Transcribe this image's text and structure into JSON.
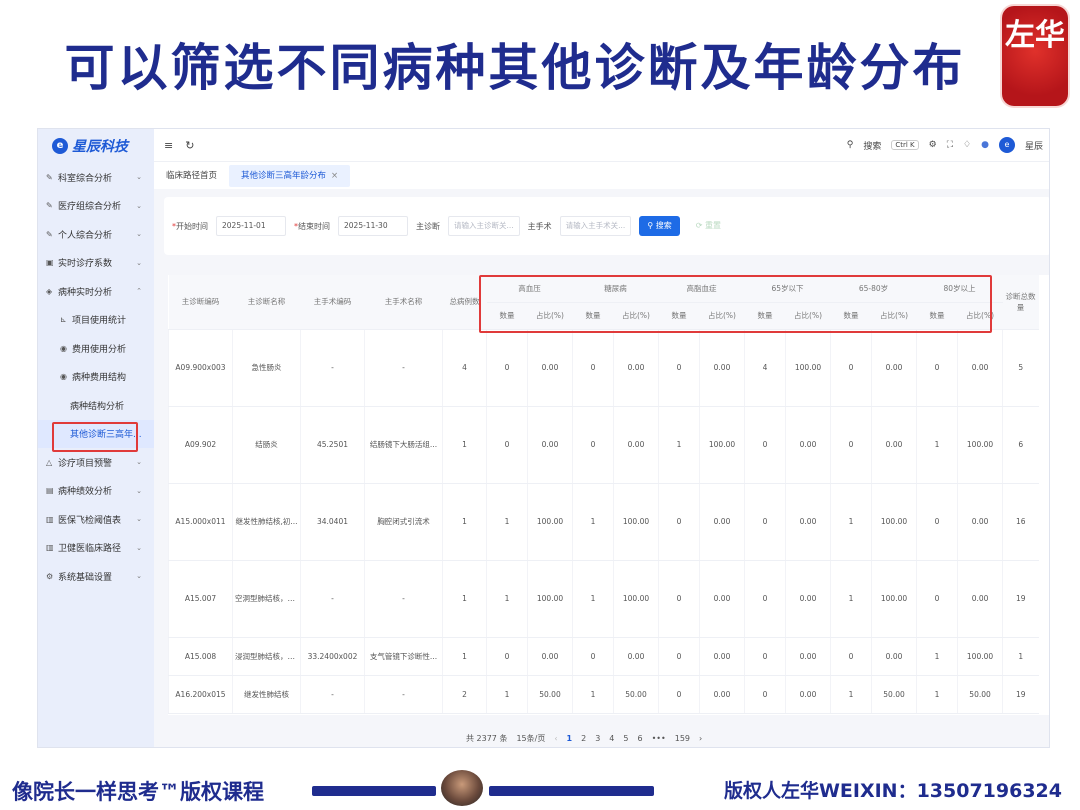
{
  "slide": {
    "title": "可以筛选不同病种其他诊断及年龄分布",
    "seal_text": "左华",
    "footer_left": "像院长一样思考™版权课程",
    "footer_right": "版权人左华WEIXIN：13507196324"
  },
  "app": {
    "logo_text": "星辰科技",
    "topbar": {
      "menu_icon": "≡",
      "refresh_icon": "↻",
      "search_label": "搜索",
      "shortcut": "Ctrl K",
      "user_name": "星辰"
    }
  },
  "sidebar": {
    "items": [
      {
        "label": "科室综合分析",
        "icon": "✎",
        "chev": "⌄"
      },
      {
        "label": "医疗组综合分析",
        "icon": "✎",
        "chev": "⌄"
      },
      {
        "label": "个人综合分析",
        "icon": "✎",
        "chev": "⌄"
      },
      {
        "label": "实时诊疗系数",
        "icon": "▣",
        "chev": "⌄"
      },
      {
        "label": "病种实时分析",
        "icon": "◈",
        "chev": "⌃"
      },
      {
        "label": "项目使用统计",
        "icon": "⊾"
      },
      {
        "label": "费用使用分析",
        "icon": "◉"
      },
      {
        "label": "病种费用结构",
        "icon": "◉"
      },
      {
        "label": "病种结构分析"
      },
      {
        "label": "其他诊断三高年..."
      },
      {
        "label": "诊疗项目预警",
        "icon": "△",
        "chev": "⌄"
      },
      {
        "label": "病种绩效分析",
        "icon": "▤",
        "chev": "⌄"
      },
      {
        "label": "医保飞检阈值表",
        "icon": "▥",
        "chev": "⌄"
      },
      {
        "label": "卫健医临床路径",
        "icon": "▥",
        "chev": "⌄"
      },
      {
        "label": "系统基础设置",
        "icon": "⚙",
        "chev": "⌄"
      }
    ]
  },
  "tabs": [
    {
      "label": "临床路径首页"
    },
    {
      "label": "其他诊断三高年龄分布",
      "close": "×"
    }
  ],
  "filters": {
    "start_label": "开始时间",
    "start_value": "2025-11-01",
    "end_label": "结束时间",
    "end_value": "2025-11-30",
    "main_diag_label": "主诊断",
    "main_diag_placeholder": "请输入主诊断关...",
    "main_op_label": "主手术",
    "main_op_placeholder": "请输入主手术关...",
    "search_button": "搜索",
    "reset_button": "重置"
  },
  "table": {
    "fixed_headers": [
      "主诊断编码",
      "主诊断名称",
      "主手术编码",
      "主手术名称",
      "总病例数"
    ],
    "group_headers": [
      "高血压",
      "糖尿病",
      "高脂血症",
      "65岁以下",
      "65-80岁",
      "80岁以上"
    ],
    "sub_headers": [
      "数量",
      "占比(%)"
    ],
    "last_header": "诊断总数量",
    "rows": [
      [
        "A09.900x003",
        "急性肠炎",
        "-",
        "-",
        "4",
        "0",
        "0.00",
        "0",
        "0.00",
        "0",
        "0.00",
        "4",
        "100.00",
        "0",
        "0.00",
        "0",
        "0.00",
        "5"
      ],
      [
        "A09.902",
        "结肠炎",
        "45.2501",
        "结肠镜下大肠活组...",
        "1",
        "0",
        "0.00",
        "0",
        "0.00",
        "1",
        "100.00",
        "0",
        "0.00",
        "0",
        "0.00",
        "1",
        "100.00",
        "6"
      ],
      [
        "A15.000x011",
        "继发性肺结核,初...",
        "34.0401",
        "胸腔闭式引流术",
        "1",
        "1",
        "100.00",
        "1",
        "100.00",
        "0",
        "0.00",
        "0",
        "0.00",
        "1",
        "100.00",
        "0",
        "0.00",
        "16"
      ],
      [
        "A15.007",
        "空洞型肺结核，痰...",
        "-",
        "-",
        "1",
        "1",
        "100.00",
        "1",
        "100.00",
        "0",
        "0.00",
        "0",
        "0.00",
        "1",
        "100.00",
        "0",
        "0.00",
        "19"
      ],
      [
        "A15.008",
        "浸润型肺结核，痰...",
        "33.2400x002",
        "支气管镜下诊断性...",
        "1",
        "0",
        "0.00",
        "0",
        "0.00",
        "0",
        "0.00",
        "0",
        "0.00",
        "0",
        "0.00",
        "1",
        "100.00",
        "1"
      ],
      [
        "A16.200x015",
        "继发性肺结核",
        "-",
        "-",
        "2",
        "1",
        "50.00",
        "1",
        "50.00",
        "0",
        "0.00",
        "0",
        "0.00",
        "1",
        "50.00",
        "1",
        "50.00",
        "19"
      ]
    ]
  },
  "pager": {
    "total": "共 2377 条",
    "page_size": "15条/页",
    "prev": "‹",
    "pages": [
      "1",
      "2",
      "3",
      "4",
      "5",
      "6"
    ],
    "ellipsis": "•••",
    "last": "159",
    "next": "›"
  }
}
